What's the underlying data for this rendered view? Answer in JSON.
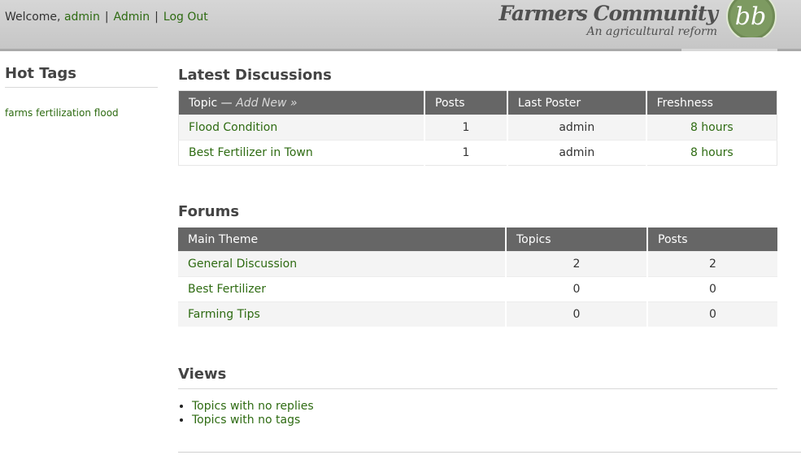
{
  "userbar": {
    "welcome": "Welcome,",
    "user_link": "admin",
    "admin_link": "Admin",
    "logout_link": "Log Out",
    "separator": "|"
  },
  "brand": {
    "title": "Farmers Community",
    "subtitle": "An agricultural reform",
    "logo_text": "bb"
  },
  "sidebar": {
    "title": "Hot Tags",
    "tags": [
      "farms",
      "fertilization",
      "flood"
    ]
  },
  "latest": {
    "title": "Latest Discussions",
    "columns": {
      "topic": "Topic —",
      "add_new": "Add New »",
      "posts": "Posts",
      "last_poster": "Last Poster",
      "freshness": "Freshness"
    },
    "rows": [
      {
        "topic": "Flood Condition",
        "posts": "1",
        "poster": "admin",
        "freshness": "8 hours"
      },
      {
        "topic": "Best Fertilizer in Town",
        "posts": "1",
        "poster": "admin",
        "freshness": "8 hours"
      }
    ]
  },
  "forums": {
    "title": "Forums",
    "columns": {
      "theme": "Main Theme",
      "topics": "Topics",
      "posts": "Posts"
    },
    "rows": [
      {
        "name": "General Discussion",
        "topics": "2",
        "posts": "2"
      },
      {
        "name": "Best Fertilizer",
        "topics": "0",
        "posts": "0"
      },
      {
        "name": "Farming Tips",
        "topics": "0",
        "posts": "0"
      }
    ]
  },
  "views": {
    "title": "Views",
    "items": [
      "Topics with no replies",
      "Topics with no tags"
    ]
  },
  "colors": {
    "link": "#2e6b12",
    "table_header": "#666666",
    "header_bg": "#cccccc"
  }
}
